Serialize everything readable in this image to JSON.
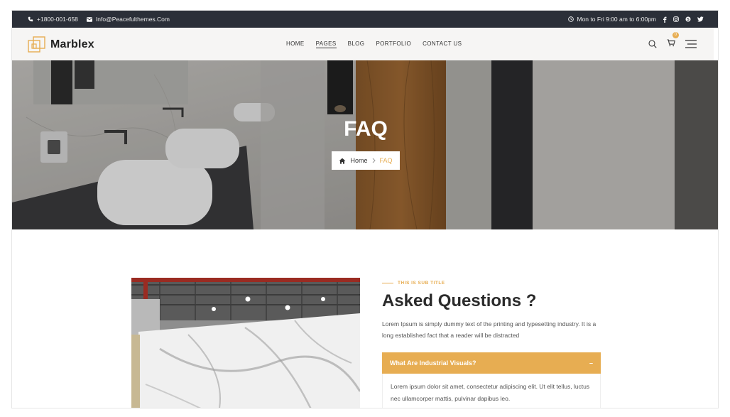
{
  "topbar": {
    "phone": "+1800-001-658",
    "email": "Info@Peacefulthemes.Com",
    "hours": "Mon to Fri 9:00 am to 6:00pm"
  },
  "header": {
    "logo_text": "Marblex",
    "nav": [
      "HOME",
      "PAGES",
      "BLOG",
      "PORTFOLIO",
      "CONTACT US"
    ],
    "active_nav": "PAGES",
    "cart_count": "0"
  },
  "hero": {
    "title": "FAQ",
    "breadcrumb_home": "Home",
    "breadcrumb_current": "FAQ"
  },
  "faq": {
    "subtitle": "THIS IS SUB TITLE",
    "heading": "Asked Questions ?",
    "paragraph": "Lorem Ipsum is simply dummy text of the printing and typesetting industry. It is a long established fact that a reader will be distracted",
    "question": "What Are Industrial Visuals?",
    "toggle": "–",
    "answer": "Lorem ipsum dolor sit amet, consectetur adipiscing elit. Ut elit tellus, luctus nec ullamcorper mattis, pulvinar dapibus leo."
  },
  "colors": {
    "accent": "#e7ad52",
    "topbar_bg": "#2b2f38",
    "header_bg": "#f6f5f4",
    "heading_text": "#2a2a2a"
  },
  "icons": [
    "phone-icon",
    "mail-icon",
    "clock-icon",
    "facebook-icon",
    "instagram-icon",
    "skype-icon",
    "twitter-icon",
    "search-icon",
    "cart-icon",
    "menu-icon",
    "home-icon"
  ]
}
